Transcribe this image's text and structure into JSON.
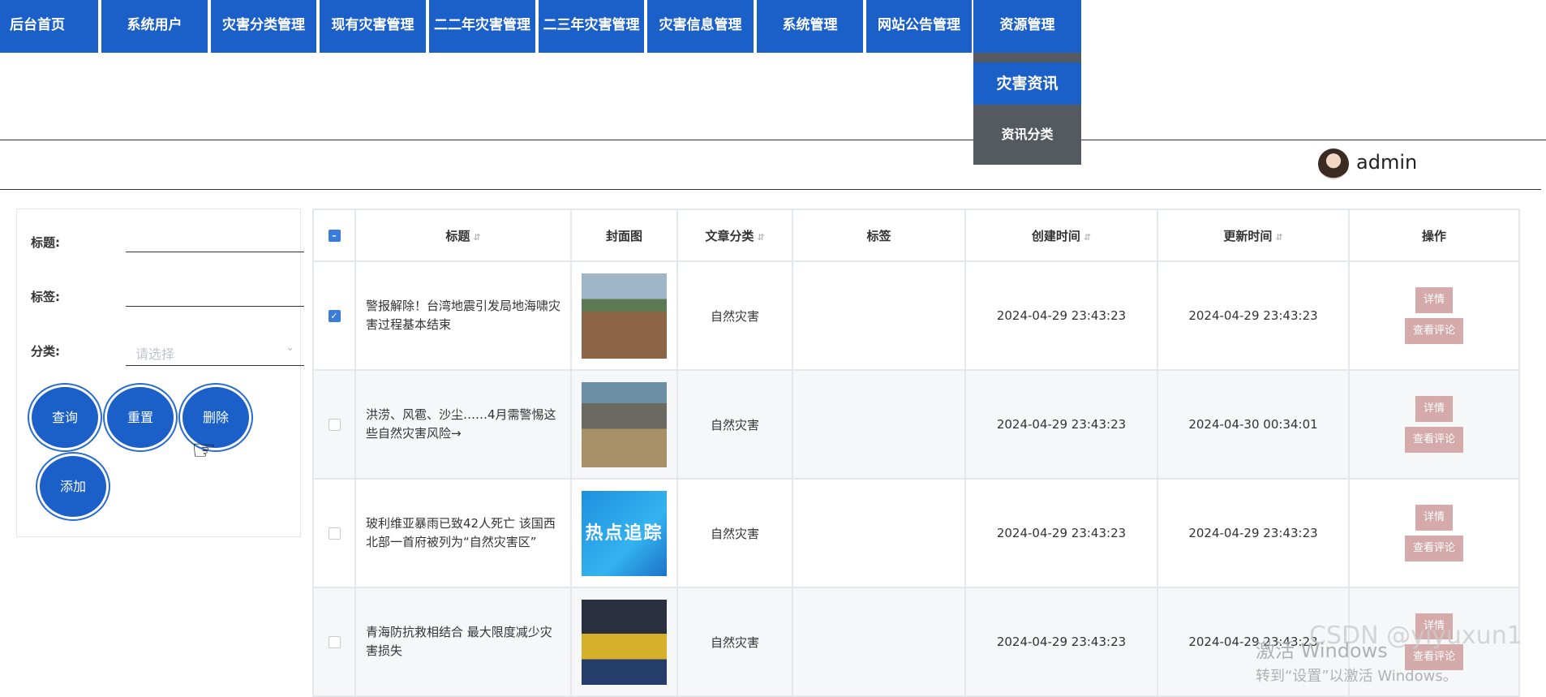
{
  "nav": {
    "items": [
      {
        "label": "后台首页"
      },
      {
        "label": "系统用户"
      },
      {
        "label": "灾害分类管理"
      },
      {
        "label": "现有灾害管理"
      },
      {
        "label": "二二年灾害管理"
      },
      {
        "label": "二三年灾害管理"
      },
      {
        "label": "灾害信息管理"
      },
      {
        "label": "系统管理"
      },
      {
        "label": "网站公告管理"
      },
      {
        "label": "资源管理"
      }
    ],
    "dropdown": [
      {
        "label": "灾害资讯"
      },
      {
        "label": "资讯分类"
      }
    ]
  },
  "header": {
    "username": "admin"
  },
  "search": {
    "title_label": "标题:",
    "tag_label": "标签:",
    "category_label": "分类:",
    "category_placeholder": "请选择",
    "buttons": {
      "query": "查询",
      "reset": "重置",
      "delete": "删除",
      "add": "添加"
    }
  },
  "table": {
    "columns": [
      "标题",
      "封面图",
      "文章分类",
      "标签",
      "创建时间",
      "更新时间",
      "操作"
    ],
    "rows": [
      {
        "title": "警报解除！台湾地震引发局地海啸灾害过程基本结束",
        "category": "自然灾害",
        "tags": "",
        "created": "2024-04-29 23:43:23",
        "updated": "2024-04-29 23:43:23",
        "checked": true
      },
      {
        "title": "洪涝、风雹、沙尘……4月需警惕这些自然灾害风险→",
        "category": "自然灾害",
        "tags": "",
        "created": "2024-04-29 23:43:23",
        "updated": "2024-04-30 00:34:01",
        "checked": false
      },
      {
        "title": "玻利维亚暴雨已致42人死亡 该国西北部一首府被列为“自然灾害区”",
        "category": "自然灾害",
        "tags": "",
        "created": "2024-04-29 23:43:23",
        "updated": "2024-04-29 23:43:23",
        "checked": false,
        "thumb_text": "热点追踪"
      },
      {
        "title": "青海防抗救相结合 最大限度减少灾害损失",
        "category": "自然灾害",
        "tags": "",
        "created": "2024-04-29 23:43:23",
        "updated": "2024-04-29 23:43:23",
        "checked": false
      }
    ],
    "actions": {
      "detail": "详情",
      "comments": "查看评论"
    }
  },
  "watermark": {
    "line1": "激活 Windows",
    "line2": "转到“设置”以激活 Windows。",
    "csdn": "CSDN @yiyuxun1"
  }
}
